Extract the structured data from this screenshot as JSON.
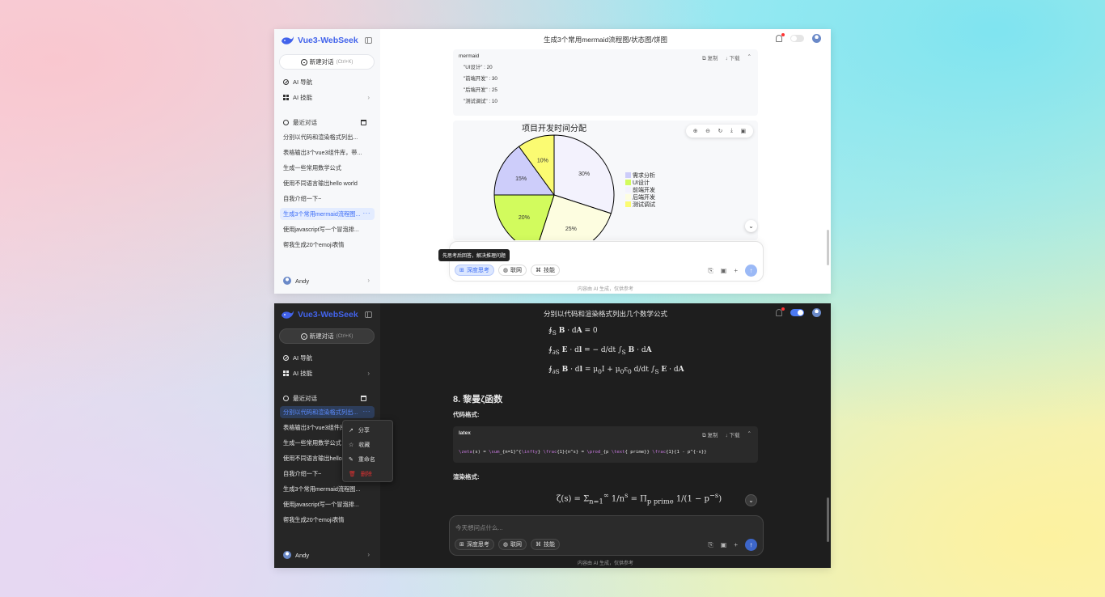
{
  "colors": {
    "accent": "#4263eb",
    "active_text": "#3b6cf6",
    "danger": "#e03131"
  },
  "brand": {
    "name": "Vue3-WebSeek"
  },
  "sidebar": {
    "new_chat": "新建对话",
    "new_chat_kbd": "(Ctrl+K)",
    "nav": {
      "ai_nav": "AI 导航",
      "ai_skills": "AI 技能"
    },
    "recent_label": "最近对话",
    "history": [
      "分别以代码和渲染格式列出几个数学公式",
      "表格输出3个vue3组件库，带链接",
      "生成一些常用数学公式",
      "使用不同语言输出hello world",
      "自我介绍一下~",
      "生成3个常用mermaid流程图/状态图/饼图",
      "使用javascript写一个冒泡排序",
      "帮我生成20个emoji表情"
    ],
    "history_display": [
      "分别以代码和渲染格式列出...",
      "表格输出3个vue3组件库，带...",
      "生成一些常用数学公式",
      "使用不同语言输出hello world",
      "自我介绍一下~",
      "生成3个常用mermaid流程图...",
      "使用javascript写一个冒泡排...",
      "帮我生成20个emoji表情"
    ],
    "more": "···",
    "user": "Andy"
  },
  "light": {
    "title": "生成3个常用mermaid流程图/状态图/饼图",
    "code": {
      "lang": "mermaid",
      "copy": "复制",
      "download": "下载",
      "lines": [
        "\"UI设计\" : 20",
        "\"前端开发\" : 30",
        "\"后端开发\" : 25",
        "\"测试调试\" : 10"
      ]
    },
    "tooltip": "先思考后回答，解决推理问题"
  },
  "dark": {
    "title": "分别以代码和渲染格式列出几个数学公式",
    "heading": "8. 黎曼ζ函数",
    "code_label": "代码格式:",
    "render_label": "渲染格式:",
    "code": {
      "lang": "latex",
      "copy": "复制",
      "download": "下载",
      "latex_parts": [
        "\\zeta",
        "(s) = ",
        "\\sum",
        "_{n=1}^{",
        "\\infty",
        "} ",
        "\\frac",
        "{1}{n^s} = ",
        "\\prod",
        "_{p ",
        "\\text",
        "{ prime}} ",
        "\\frac",
        "{1}{1 - p^{-s}}"
      ]
    },
    "placeholder": "今天想问点什么...",
    "context_menu": {
      "share": "分享",
      "favorite": "收藏",
      "rename": "重命名",
      "delete": "删除"
    }
  },
  "input": {
    "deep_think": "深度思考",
    "web": "联网",
    "skills": "技能"
  },
  "disclaimer": "内容由 AI 生成，仅供参考",
  "chart_data": {
    "type": "pie",
    "title": "项目开发时间分配",
    "categories": [
      "需求分析",
      "UI设计",
      "前端开发",
      "后端开发",
      "测试调试"
    ],
    "values": [
      15,
      20,
      30,
      25,
      10
    ],
    "labels": [
      "15%",
      "20%",
      "30%",
      "25%",
      "10%"
    ],
    "colors": [
      "#cdcdfa",
      "#d2fb5d",
      "#f3f2fd",
      "#fdfde0",
      "#fbfb72"
    ],
    "legend": "right"
  }
}
